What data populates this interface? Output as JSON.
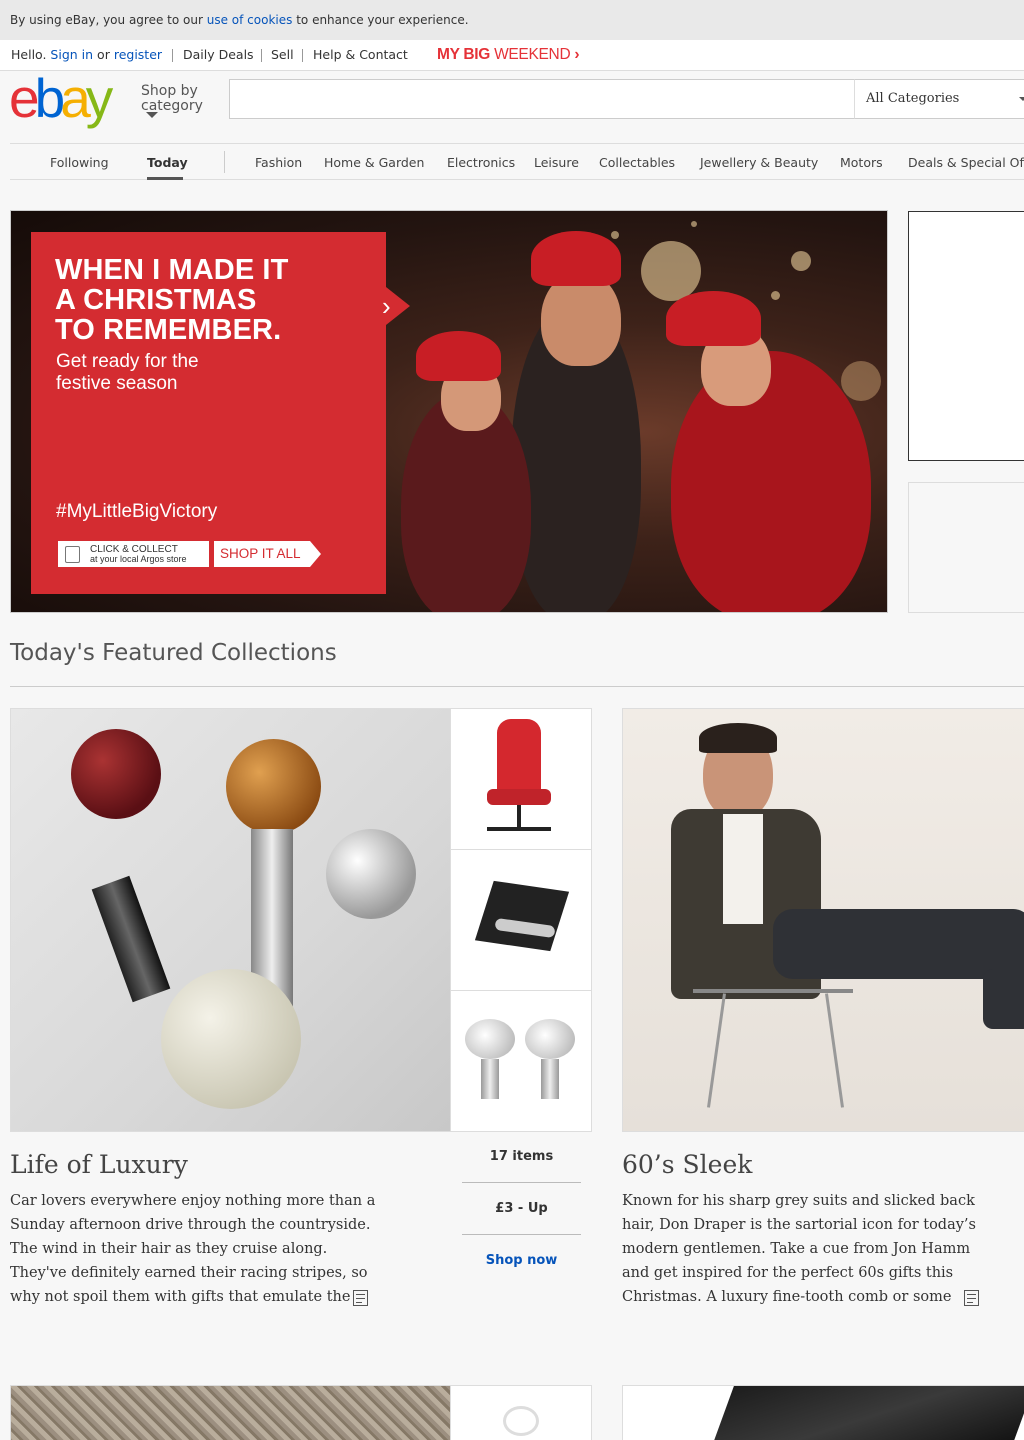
{
  "cookie_bar": {
    "prefix": "By using eBay, you agree to our",
    "link": "use of cookies",
    "suffix": "to enhance your experience."
  },
  "topbar": {
    "hello": "Hello.",
    "sign_in": "Sign in",
    "or": "or",
    "register": "register",
    "links": [
      "Daily Deals",
      "Sell",
      "Help & Contact"
    ],
    "promo_bold": "MY BIG",
    "promo_thin": "WEEKEND",
    "promo_chevron": "›"
  },
  "logo": {
    "letters": [
      "e",
      "b",
      "a",
      "y"
    ],
    "colors": [
      "#e53238",
      "#0064d2",
      "#f5af02",
      "#86b817"
    ]
  },
  "shop_by_category": {
    "line1": "Shop by",
    "line2": "category"
  },
  "search": {
    "value": "",
    "placeholder": "",
    "category": "All Categories"
  },
  "nav": {
    "following": "Following",
    "today": "Today",
    "categories": [
      "Fashion",
      "Home & Garden",
      "Electronics",
      "Leisure",
      "Collectables",
      "Jewellery & Beauty",
      "Motors",
      "Deals & Special Off"
    ]
  },
  "hero": {
    "headline_lines": [
      "WHEN I MADE IT",
      "A CHRISTMAS",
      "TO REMEMBER."
    ],
    "sub_lines": [
      "Get ready for the",
      "festive season"
    ],
    "hashtag": "#MyLittleBigVictory",
    "click_collect_line1": "CLICK & COLLECT",
    "click_collect_line2": "at your local Argos store",
    "shop_it_all": "SHOP IT ALL",
    "accent": "#d42c31"
  },
  "featured": {
    "title": "Today's Featured Collections",
    "collections": [
      {
        "title": "Life of Luxury",
        "desc_lines": [
          "Car lovers everywhere enjoy nothing more than a",
          "Sunday afternoon drive through the countryside.",
          "The wind in their hair as they cruise along.",
          "They've definitely earned their racing stripes, so",
          "why not spoil them with gifts that emulate the"
        ],
        "items": "17 items",
        "price": "£3 - Up",
        "cta": "Shop now"
      },
      {
        "title": "60’s Sleek",
        "desc_lines": [
          "Known for his sharp grey suits and slicked back",
          "hair, Don Draper is the sartorial icon for today’s",
          "modern gentlemen. Take a cue from Jon Hamm",
          "and get inspired for the perfect 60s gifts this",
          "Christmas. A luxury fine-tooth comb or some"
        ]
      }
    ]
  },
  "link_color": "#0654ba"
}
